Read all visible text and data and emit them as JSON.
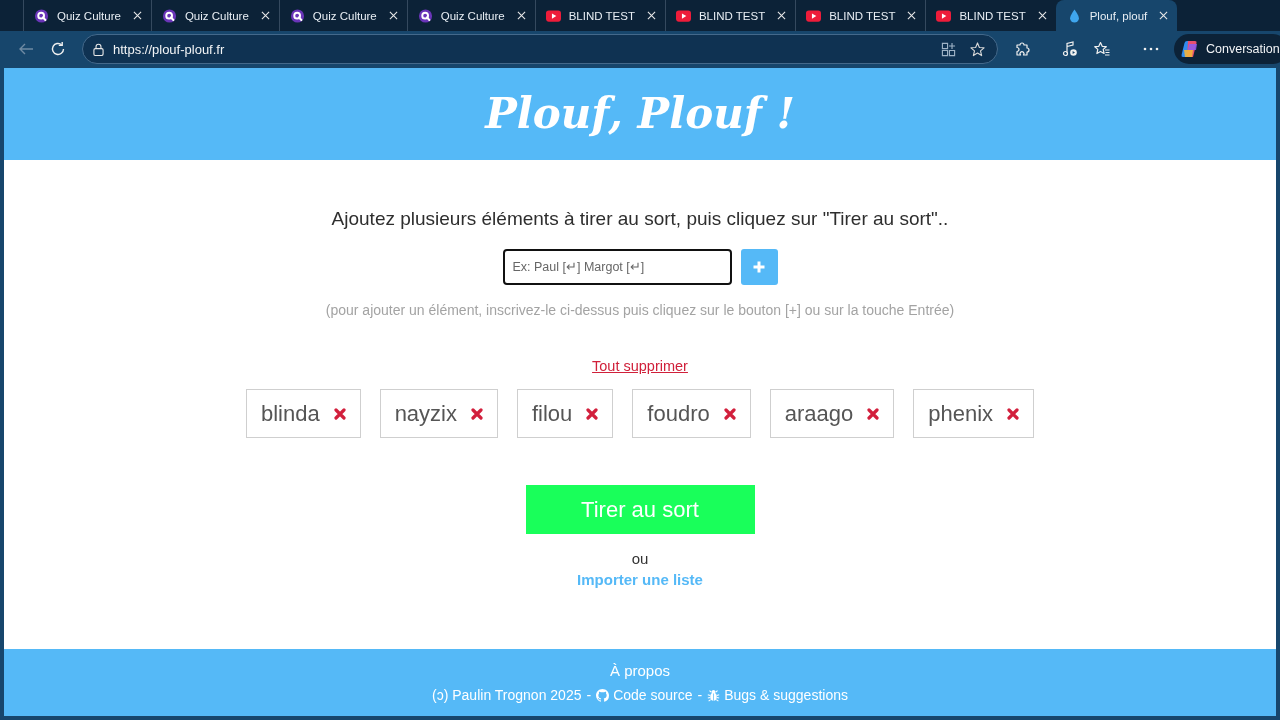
{
  "browser": {
    "tabs": [
      {
        "kind": "quiz",
        "title": "Quiz Culture",
        "selected": false
      },
      {
        "kind": "quiz",
        "title": "Quiz Culture",
        "selected": false
      },
      {
        "kind": "quiz",
        "title": "Quiz Culture",
        "selected": false
      },
      {
        "kind": "quiz",
        "title": "Quiz Culture",
        "selected": false
      },
      {
        "kind": "video",
        "title": "BLIND TEST",
        "selected": false
      },
      {
        "kind": "video",
        "title": "BLIND TEST",
        "selected": false
      },
      {
        "kind": "video",
        "title": "BLIND TEST",
        "selected": false
      },
      {
        "kind": "video",
        "title": "BLIND TEST",
        "selected": false
      },
      {
        "kind": "drop",
        "title": "Plouf, plouf",
        "selected": true
      }
    ],
    "back": {
      "disabled": true
    },
    "address": "https://plouf-plouf.fr",
    "copilot": "Conversation"
  },
  "header": {
    "title": "Plouf, Plouf !"
  },
  "intro": "Ajoutez plusieurs éléments à tirer au sort, puis cliquez sur \"Tirer au sort\"..",
  "entry": {
    "placeholder": "Ex: Paul [↵] Margot [↵]"
  },
  "hint": "(pour ajouter un élément, inscrivez-le ci-dessus puis cliquez sur le bouton [+] ou sur la touche Entrée)",
  "clear_all": "Tout supprimer",
  "items": [
    {
      "label": "blinda"
    },
    {
      "label": "nayzix"
    },
    {
      "label": "filou"
    },
    {
      "label": "foudro"
    },
    {
      "label": "araago"
    },
    {
      "label": "phenix"
    }
  ],
  "draw_button": "Tirer au sort",
  "or": "ou",
  "import_link": "Importer une liste",
  "footer": {
    "about": "À propos",
    "copyright": "(ɔ) Paulin Trognon 2025",
    "separators": [
      "-",
      "-"
    ],
    "source_link": "Code source",
    "bugs_link": "Bugs & suggestions"
  }
}
